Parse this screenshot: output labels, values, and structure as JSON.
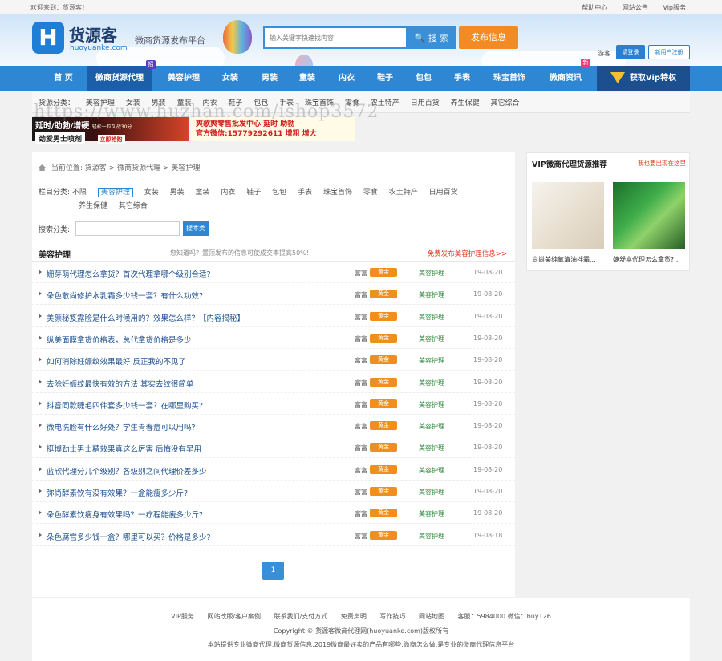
{
  "topbar": {
    "welcome": "欢迎来到：货源客！",
    "links": [
      "帮助中心",
      "网站公告",
      "Vip服务"
    ]
  },
  "header": {
    "logo_letter": "H",
    "logo_name": "货源客",
    "logo_domain": "huoyuanke.com",
    "slogan": "微商货源发布平台",
    "search_placeholder": "输入关键字快速找内容",
    "search_btn": "🔍 搜 索",
    "publish_btn": "发布信息",
    "guest": "游客",
    "login": "请登录",
    "register": "新用户注册"
  },
  "nav": {
    "items": [
      "首 页",
      "微商货源代理",
      "美容护理",
      "女装",
      "男装",
      "童装",
      "内衣",
      "鞋子",
      "包包",
      "手表",
      "珠宝首饰",
      "微商资讯"
    ],
    "badge_hot": "招",
    "badge_new": "新",
    "vip": "获取Vip特权"
  },
  "subnav": {
    "label": "货源分类：",
    "items": [
      "美容护理",
      "女装",
      "男装",
      "童装",
      "内衣",
      "鞋子",
      "包包",
      "手表",
      "珠宝首饰",
      "零食",
      "农土特产",
      "日用百货",
      "养生保健",
      "其它综合"
    ]
  },
  "ads": {
    "ad1_main": "延时/助勃/增硬",
    "ad1_tag": "轻松一粒久战30分",
    "ad1_sub": "劲爱男士喷剂",
    "ad1_btn": "立即抢购",
    "ad2_line1": "爽歌爽零售批发中心  延时 助勃",
    "ad2_line2": "官方微信:15779292611 增粗 增大"
  },
  "watermark": "https://www.huzhan.com/ishop3572",
  "main": {
    "crumb": [
      "当前位置:",
      "货源客",
      ">",
      "微商货源代理",
      ">",
      "美容护理"
    ],
    "cats_label": "栏目分类:",
    "cats": [
      "不限",
      "美容护理",
      "女装",
      "男装",
      "童装",
      "内衣",
      "鞋子",
      "包包",
      "手表",
      "珠宝首饰",
      "零食",
      "农土特产",
      "日用百货",
      "养生保健",
      "其它综合"
    ],
    "search_label": "搜索分类:",
    "search_btn": "搜本类",
    "list_title": "美容护理",
    "list_tip": "您知道吗？置顶发布的信息可使成交率提高50%!",
    "list_pub": "免费发布美容护理信息>>",
    "rows": [
      {
        "title": "姗芽萌代理怎么拿货？首次代理拿哪个级别合适?",
        "user": "富富",
        "gold": "黄金",
        "cat": "美容护理",
        "date": "19-08-20"
      },
      {
        "title": "朵色散尚修护水乳霜多少钱一套？有什么功效?",
        "user": "富富",
        "gold": "黄金",
        "cat": "美容护理",
        "date": "19-08-20"
      },
      {
        "title": "美颜秘笈露脸是什么时候用的？效果怎么样？【内容揭秘】",
        "user": "富富",
        "gold": "黄金",
        "cat": "美容护理",
        "date": "19-08-20"
      },
      {
        "title": "纵美面膜拿货价格表，总代拿货价格是多少",
        "user": "富富",
        "gold": "黄金",
        "cat": "美容护理",
        "date": "19-08-20"
      },
      {
        "title": "如何消除妊娠纹效果最好 反正我的不见了",
        "user": "富富",
        "gold": "黄金",
        "cat": "美容护理",
        "date": "19-08-20"
      },
      {
        "title": "去除妊娠纹最快有效的方法 其实去纹很简单",
        "user": "富富",
        "gold": "黄金",
        "cat": "美容护理",
        "date": "19-08-20"
      },
      {
        "title": "抖音同款睫毛四件套多少钱一套？在哪里购买?",
        "user": "富富",
        "gold": "黄金",
        "cat": "美容护理",
        "date": "19-08-20"
      },
      {
        "title": "微电洗脸有什么好处？学生青春痘可以用吗?",
        "user": "富富",
        "gold": "黄金",
        "cat": "美容护理",
        "date": "19-08-20"
      },
      {
        "title": "挺博劲士男士精效果真这么厉害 后悔没有早用",
        "user": "富富",
        "gold": "黄金",
        "cat": "美容护理",
        "date": "19-08-20"
      },
      {
        "title": "蓝欣代理分几个级别？各级别之间代理价差多少",
        "user": "富富",
        "gold": "黄金",
        "cat": "美容护理",
        "date": "19-08-20"
      },
      {
        "title": "弥尚酵素饮有没有效果？一盒能瘦多少斤?",
        "user": "富富",
        "gold": "黄金",
        "cat": "美容护理",
        "date": "19-08-20"
      },
      {
        "title": "朵色酵素饮瘦身有效果吗？一疗程能瘦多少斤?",
        "user": "富富",
        "gold": "黄金",
        "cat": "美容护理",
        "date": "19-08-20"
      },
      {
        "title": "朵色腐宫多少钱一盒？哪里可以买？价格是多少?",
        "user": "富富",
        "gold": "黄金",
        "cat": "美容护理",
        "date": "19-08-18"
      }
    ],
    "page": "1"
  },
  "side": {
    "title": "VIP微商代理货源推荐",
    "more": "我也要出现在这里",
    "cap1": "尚尚美纯氧清油拌霜...",
    "cap2": "婕舒本代理怎么拿货?..."
  },
  "footer": {
    "links": [
      "VIP服务",
      "网站改版/客户案例",
      "联系我们/支付方式",
      "免责声明",
      "写作技巧",
      "网站地图",
      "客服：5984000 微信：buy126"
    ],
    "copy": "Copyright © 货源客微商代理网(huoyuanke.com)版权所有",
    "desc": "本站提供专业微商代理,微商货源信息,2019微商最好卖的产品有哪些,微商怎么做,是专业的微商代理信息平台"
  }
}
